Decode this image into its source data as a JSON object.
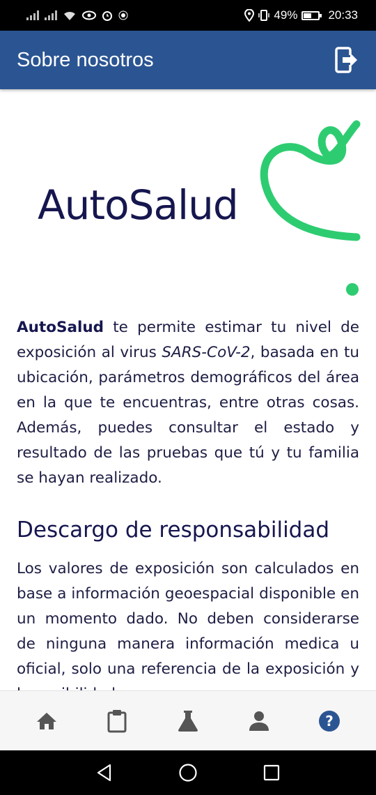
{
  "status_bar": {
    "battery": "49%",
    "time": "20:33",
    "icons": [
      "signal-icon",
      "wifi-icon",
      "eye-icon",
      "alarm-icon",
      "location-icon",
      "vibrate-icon",
      "battery-icon"
    ]
  },
  "app_bar": {
    "title": "Sobre nosotros",
    "action_icon": "logout-icon"
  },
  "logo": {
    "text": "AutoSalud",
    "accent_color": "#2ecc71"
  },
  "about": {
    "brand": "AutoSalud",
    "text_a": " te permite estimar tu nivel de exposición al virus ",
    "virus": "SARS-CoV-2",
    "text_b": ", basada en tu ubicación, parámetros demográficos del área en la que te encuentras, entre otras cosas. Además, puedes consultar el estado y resultado de las pruebas que tú y tu familia se hayan realizado."
  },
  "disclaimer": {
    "heading": "Descargo de responsabilidad",
    "text": "Los valores de exposición son calculados en base a información geoespacial disponible en un momento dado. No deben considerarse de ninguna manera información medica u oficial, solo una referencia de la exposición y la posibilidad"
  },
  "bottom_nav": {
    "items": [
      "home-icon",
      "clipboard-icon",
      "flask-icon",
      "person-icon",
      "help-icon"
    ],
    "active": "help-icon"
  },
  "colors": {
    "primary": "#2b5592",
    "text": "#1d1d44",
    "accent": "#2ecc71"
  }
}
